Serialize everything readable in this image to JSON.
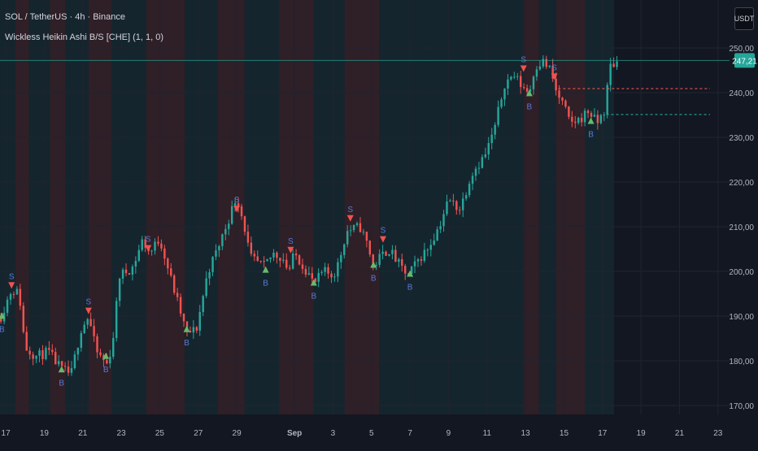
{
  "header": {
    "symbol_title": "SOL / TetherUS · 4h · Binance",
    "indicator_title": "Wickless Heikin Ashi B/S [CHE] (1, 1, 0)",
    "currency_button": "USDT"
  },
  "colors": {
    "background": "#131722",
    "grid": "#1f2430",
    "bull": "#26a69a",
    "bear": "#ef5350",
    "buy_marker": "#66bb6a",
    "sell_marker": "#ef5350",
    "label_blue": "#5b7ad6",
    "bull_zone": "rgba(38,166,154,0.10)",
    "bear_zone": "rgba(239,83,80,0.13)",
    "price_line": "#26a69a",
    "resistance_line": "#ef5350",
    "support_line": "#26a69a",
    "axis_text": "#b2b5be"
  },
  "chart_data": {
    "type": "candlestick",
    "y_ticks": [
      "170,00",
      "180,00",
      "190,00",
      "200,00",
      "210,00",
      "220,00",
      "230,00",
      "240,00",
      "250,00"
    ],
    "y_tick_values": [
      170,
      180,
      190,
      200,
      210,
      220,
      230,
      240,
      250
    ],
    "ylim": [
      168,
      252
    ],
    "x_ticks": [
      {
        "label": "17",
        "day": 17
      },
      {
        "label": "19",
        "day": 19
      },
      {
        "label": "21",
        "day": 21
      },
      {
        "label": "23",
        "day": 23
      },
      {
        "label": "25",
        "day": 25
      },
      {
        "label": "27",
        "day": 27
      },
      {
        "label": "29",
        "day": 29
      },
      {
        "label": "Sep",
        "day": 32,
        "bold": true
      },
      {
        "label": "3",
        "day": 34
      },
      {
        "label": "5",
        "day": 36
      },
      {
        "label": "7",
        "day": 38
      },
      {
        "label": "9",
        "day": 40
      },
      {
        "label": "11",
        "day": 42
      },
      {
        "label": "13",
        "day": 44
      },
      {
        "label": "15",
        "day": 46
      },
      {
        "label": "17",
        "day": 48
      },
      {
        "label": "19",
        "day": 50
      },
      {
        "label": "21",
        "day": 52
      },
      {
        "label": "23",
        "day": 54
      }
    ],
    "xlim": [
      16.7,
      54.6
    ],
    "last_price": {
      "label": "247,21",
      "value": 247.2
    },
    "resistance_level": {
      "value": 240.9,
      "from_day": 45.7
    },
    "support_level": {
      "value": 235.1,
      "from_day": 48.2
    },
    "path": [
      [
        16.75,
        190
      ],
      [
        17.3,
        196
      ],
      [
        17.7,
        195
      ],
      [
        18.0,
        183
      ],
      [
        18.6,
        181
      ],
      [
        19.2,
        182
      ],
      [
        19.9,
        178
      ],
      [
        20.4,
        177
      ],
      [
        20.9,
        187
      ],
      [
        21.3,
        190
      ],
      [
        21.7,
        182
      ],
      [
        22.3,
        179
      ],
      [
        22.6,
        186
      ],
      [
        22.9,
        199
      ],
      [
        23.6,
        201
      ],
      [
        24.1,
        207
      ],
      [
        24.5,
        204
      ],
      [
        24.9,
        207
      ],
      [
        25.1,
        206
      ],
      [
        25.6,
        198
      ],
      [
        26.0,
        192
      ],
      [
        26.4,
        186
      ],
      [
        26.9,
        187
      ],
      [
        27.5,
        200
      ],
      [
        28.0,
        205
      ],
      [
        28.6,
        212
      ],
      [
        29.0,
        217
      ],
      [
        29.4,
        210
      ],
      [
        29.7,
        203
      ],
      [
        30.4,
        201
      ],
      [
        30.9,
        204
      ],
      [
        31.4,
        203
      ],
      [
        31.7,
        200
      ],
      [
        32.0,
        204
      ],
      [
        32.5,
        201
      ],
      [
        32.8,
        199
      ],
      [
        33.0,
        197
      ],
      [
        33.5,
        200
      ],
      [
        34.0,
        199
      ],
      [
        34.3,
        202
      ],
      [
        34.7,
        209
      ],
      [
        35.4,
        210
      ],
      [
        35.8,
        206
      ],
      [
        36.1,
        201
      ],
      [
        36.4,
        203
      ],
      [
        36.9,
        205
      ],
      [
        37.5,
        201
      ],
      [
        37.9,
        199
      ],
      [
        38.5,
        203
      ],
      [
        38.9,
        205
      ],
      [
        39.5,
        210
      ],
      [
        40.0,
        216
      ],
      [
        40.6,
        214
      ],
      [
        41.2,
        222
      ],
      [
        41.9,
        226
      ],
      [
        42.4,
        232
      ],
      [
        42.9,
        242
      ],
      [
        43.4,
        244
      ],
      [
        43.7,
        242
      ],
      [
        44.2,
        240
      ],
      [
        44.5,
        246
      ],
      [
        44.9,
        247
      ],
      [
        45.3,
        245
      ],
      [
        45.6,
        240
      ],
      [
        46.0,
        237
      ],
      [
        46.3,
        233
      ],
      [
        46.8,
        234
      ],
      [
        47.3,
        236
      ],
      [
        47.7,
        233
      ],
      [
        48.1,
        236
      ],
      [
        48.4,
        246
      ],
      [
        48.9,
        247.2
      ]
    ],
    "zones": [
      {
        "from": 16.7,
        "to": 17.5,
        "trend": "bull"
      },
      {
        "from": 17.5,
        "to": 18.2,
        "trend": "bear"
      },
      {
        "from": 18.2,
        "to": 19.3,
        "trend": "bull"
      },
      {
        "from": 19.3,
        "to": 20.1,
        "trend": "bear"
      },
      {
        "from": 20.1,
        "to": 21.3,
        "trend": "bull"
      },
      {
        "from": 21.3,
        "to": 22.5,
        "trend": "bear"
      },
      {
        "from": 22.5,
        "to": 24.3,
        "trend": "bull"
      },
      {
        "from": 24.3,
        "to": 26.3,
        "trend": "bear"
      },
      {
        "from": 26.3,
        "to": 28.0,
        "trend": "bull"
      },
      {
        "from": 28.0,
        "to": 29.4,
        "trend": "bear"
      },
      {
        "from": 29.4,
        "to": 31.2,
        "trend": "bull"
      },
      {
        "from": 31.2,
        "to": 33.0,
        "trend": "bear"
      },
      {
        "from": 33.0,
        "to": 34.6,
        "trend": "bull"
      },
      {
        "from": 34.6,
        "to": 36.4,
        "trend": "bear"
      },
      {
        "from": 36.4,
        "to": 38.8,
        "trend": "bull"
      },
      {
        "from": 38.8,
        "to": 43.9,
        "trend": "bull"
      },
      {
        "from": 43.9,
        "to": 44.7,
        "trend": "bear"
      },
      {
        "from": 44.7,
        "to": 45.6,
        "trend": "bull"
      },
      {
        "from": 45.6,
        "to": 47.1,
        "trend": "bear"
      },
      {
        "from": 47.1,
        "to": 48.6,
        "trend": "bull"
      }
    ],
    "signals": [
      {
        "day": 16.8,
        "type": "buy",
        "price": 190.5,
        "label": "B"
      },
      {
        "day": 17.3,
        "type": "sell",
        "price": 196.5,
        "label": "S"
      },
      {
        "day": 19.9,
        "type": "buy",
        "price": 178.5,
        "label": "B"
      },
      {
        "day": 21.3,
        "type": "sell",
        "price": 190.8,
        "label": "S"
      },
      {
        "day": 22.2,
        "type": "buy",
        "price": 181.5,
        "label": "B"
      },
      {
        "day": 24.4,
        "type": "sell",
        "price": 204.8,
        "label": "S"
      },
      {
        "day": 26.4,
        "type": "buy",
        "price": 187.5,
        "label": "B"
      },
      {
        "day": 29.0,
        "type": "sell",
        "price": 213.6,
        "label": "S"
      },
      {
        "day": 30.5,
        "type": "buy",
        "price": 200.8,
        "label": "B"
      },
      {
        "day": 31.8,
        "type": "sell",
        "price": 204.4,
        "label": "S"
      },
      {
        "day": 33.0,
        "type": "buy",
        "price": 197.9,
        "label": "B"
      },
      {
        "day": 34.9,
        "type": "sell",
        "price": 211.5,
        "label": "S"
      },
      {
        "day": 36.1,
        "type": "buy",
        "price": 201.9,
        "label": "B"
      },
      {
        "day": 36.6,
        "type": "sell",
        "price": 206.8,
        "label": "S"
      },
      {
        "day": 38.0,
        "type": "buy",
        "price": 199.9,
        "label": "B"
      },
      {
        "day": 43.9,
        "type": "sell",
        "price": 245.0,
        "label": "S"
      },
      {
        "day": 44.2,
        "type": "buy",
        "price": 240.3,
        "label": "B"
      },
      {
        "day": 45.5,
        "type": "sell",
        "price": 243.2,
        "label": "S"
      },
      {
        "day": 47.4,
        "type": "buy",
        "price": 234.1,
        "label": "B"
      }
    ]
  }
}
